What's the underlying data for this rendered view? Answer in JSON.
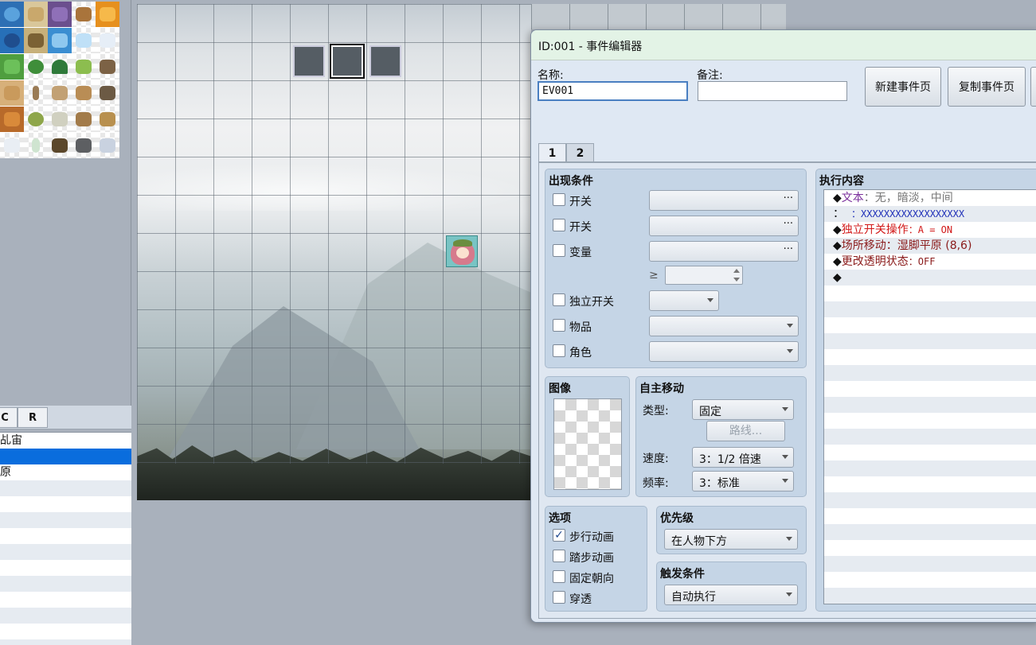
{
  "layer_tabs": [
    "C",
    "R"
  ],
  "map_list": {
    "items": [
      "乩宙",
      "",
      "原",
      "",
      "",
      "",
      "",
      "",
      "",
      "",
      "",
      "",
      "",
      ""
    ],
    "selected_index": 1
  },
  "dialog": {
    "title": "ID:001 - 事件编辑器",
    "name_label": "名称:",
    "name_value": "EV001",
    "note_label": "备注:",
    "note_value": "",
    "buttons": {
      "new_page": "新建事件页",
      "copy_page": "复制事件页"
    },
    "page_tabs": [
      "1",
      "2"
    ],
    "active_page": "1",
    "conditions": {
      "title": "出现条件",
      "switch1": "开关",
      "switch2": "开关",
      "variable": "变量",
      "ge_symbol": "≥",
      "self_switch": "独立开关",
      "item": "物品",
      "actor": "角色",
      "dots": "···"
    },
    "image": {
      "title": "图像"
    },
    "autonomous": {
      "title": "自主移动",
      "type_label": "类型:",
      "type_value": "固定",
      "route_button": "路线...",
      "speed_label": "速度:",
      "speed_value": "3：1/2 倍速",
      "freq_label": "频率:",
      "freq_value": "3：标准"
    },
    "options": {
      "title": "选项",
      "walk_anim": "步行动画",
      "walk_anim_checked": true,
      "step_anim": "踏步动画",
      "dir_fix": "固定朝向",
      "through": "穿透"
    },
    "priority": {
      "title": "优先级",
      "value": "在人物下方"
    },
    "trigger": {
      "title": "触发条件",
      "value": "自动执行"
    },
    "contents": {
      "title": "执行内容",
      "lines": [
        {
          "prefix": "◆",
          "head": "文本",
          "body": "：无，暗淡，中间",
          "color": "#7a2f9b",
          "body_color": "#777777"
        },
        {
          "prefix": "：",
          "head": "",
          "body": "：XXXXXXXXXXXXXXXXXX",
          "color": "#333333",
          "body_color": "#1f2fb8",
          "indent": true
        },
        {
          "prefix": "◆",
          "head": "独立开关操作",
          "body": "：A = ON",
          "color": "#d11818",
          "body_color": "#d11818"
        },
        {
          "prefix": "◆",
          "head": "场所移动",
          "body": "：湿脚平原 (8,6)",
          "color": "#8a1a1a",
          "body_color": "#8a1a1a"
        },
        {
          "prefix": "◆",
          "head": "更改透明状态",
          "body": "：OFF",
          "color": "#8a1a1a",
          "body_color": "#8a1a1a"
        },
        {
          "prefix": "◆",
          "head": "",
          "body": "",
          "color": "#111111",
          "body_color": "#111111"
        }
      ]
    }
  },
  "colors": {
    "selection": "#0a6ddd",
    "titlebar": "#e3f3e6",
    "panel": "#c5d5e6"
  }
}
